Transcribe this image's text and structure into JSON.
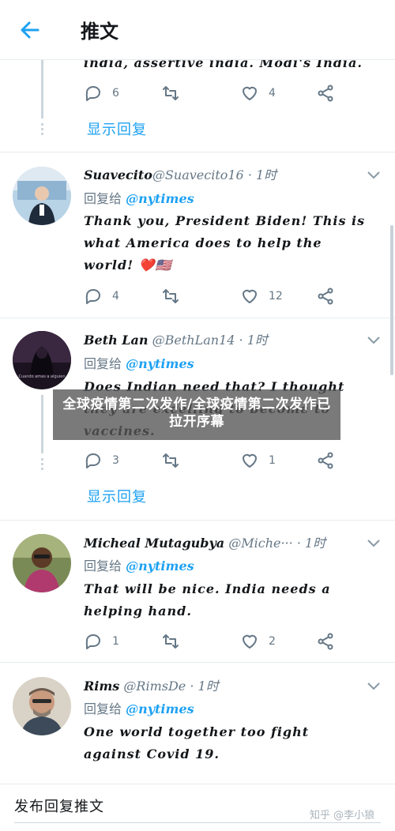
{
  "header": {
    "title": "推文"
  },
  "colors": {
    "accent": "#1da1f2",
    "muted": "#657786",
    "heart": "#e0245e"
  },
  "thread_top": {
    "text_cut": "india, assertive india. Modi's India.",
    "replies": "6",
    "likes": "4",
    "show_replies": "显示回复"
  },
  "tweets": [
    {
      "name": "Suavecito",
      "handle": "@Suavecito16",
      "time": "· 1时",
      "reply_prefix": "回复给",
      "reply_to": "@nytimes",
      "text": "Thank you, President Biden! This is\nwhat America does to help the\nworld! ❤️🇺🇸",
      "replies": "4",
      "likes": "12"
    },
    {
      "name": "Beth Lan",
      "handle": "@BethLan14",
      "time": "· 1时",
      "reply_prefix": "回复给",
      "reply_to": "@nytimes",
      "text": "Does Indian need that? I thought\nthey are excelling to become to\nvaccines.",
      "replies": "3",
      "likes": "1",
      "show_replies": "显示回复",
      "avatar_caption": "Cuando amas a alguien"
    },
    {
      "name": "Micheal Mutagubya",
      "handle": "@Miche···",
      "time": "· 1时",
      "reply_prefix": "回复给",
      "reply_to": "@nytimes",
      "text": "That will be nice. India needs a\nhelping hand.",
      "replies": "1",
      "likes": "2"
    },
    {
      "name": "Rims",
      "handle": "@RimsDe",
      "time": "· 1时",
      "reply_prefix": "回复给",
      "reply_to": "@nytimes",
      "text": "One world together too fight\nagainst  Covid 19."
    }
  ],
  "overlay": {
    "headline": "全球疫情第二次发作/全球疫情第二次发作已拉开序幕"
  },
  "composer": {
    "placeholder": "发布回复推文"
  },
  "watermark": "知乎 @李小狼"
}
